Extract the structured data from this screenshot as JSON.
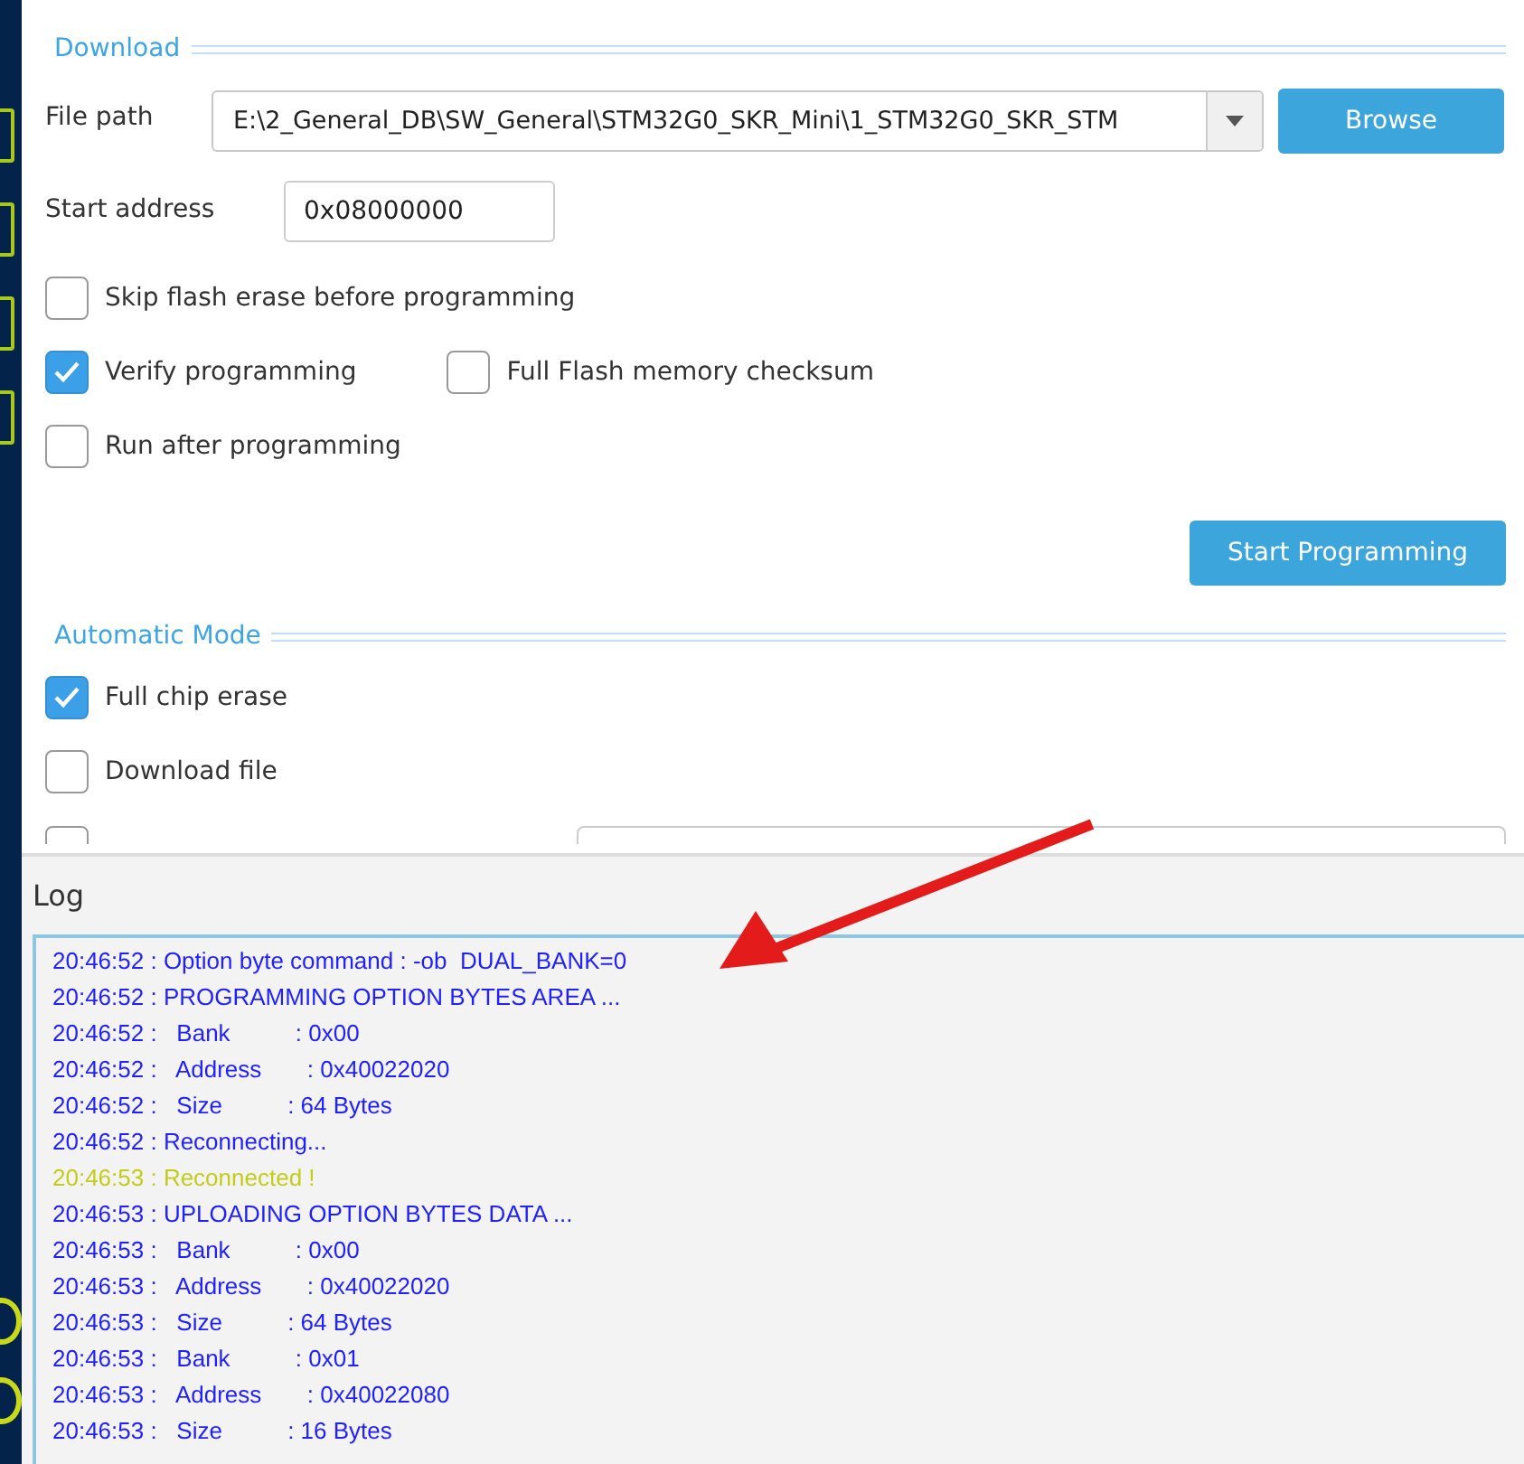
{
  "download": {
    "title": "Download",
    "file_path": {
      "label": "File path",
      "value": "E:\\2_General_DB\\SW_General\\STM32G0_SKR_Mini\\1_STM32G0_SKR_STM",
      "browse": "Browse"
    },
    "start_address": {
      "label": "Start address",
      "value": "0x08000000"
    },
    "options": [
      {
        "label": "Skip flash erase before programming",
        "checked": false
      },
      {
        "label": "Verify programming",
        "checked": true
      },
      {
        "label": "Full Flash memory checksum",
        "checked": false
      },
      {
        "label": "Run after programming",
        "checked": false
      }
    ],
    "start_button": "Start Programming"
  },
  "automatic_mode": {
    "title": "Automatic Mode",
    "options": [
      {
        "label": "Full chip erase",
        "checked": true
      },
      {
        "label": "Download file",
        "checked": false
      }
    ],
    "partial_option": {
      "checked": false
    }
  },
  "log": {
    "title": "Log",
    "lines": [
      {
        "kind": "info",
        "text": "20:46:52 : Option byte command : -ob  DUAL_BANK=0"
      },
      {
        "kind": "info",
        "text": "20:46:52 : PROGRAMMING OPTION BYTES AREA ..."
      },
      {
        "kind": "info",
        "text": "20:46:52 :   Bank          : 0x00"
      },
      {
        "kind": "info",
        "text": "20:46:52 :   Address       : 0x40022020"
      },
      {
        "kind": "info",
        "text": "20:46:52 :   Size          : 64 Bytes"
      },
      {
        "kind": "info",
        "text": "20:46:52 : Reconnecting..."
      },
      {
        "kind": "success",
        "text": "20:46:53 : Reconnected !"
      },
      {
        "kind": "info",
        "text": "20:46:53 : UPLOADING OPTION BYTES DATA ..."
      },
      {
        "kind": "info",
        "text": "20:46:53 :   Bank          : 0x00"
      },
      {
        "kind": "info",
        "text": "20:46:53 :   Address       : 0x40022020"
      },
      {
        "kind": "info",
        "text": "20:46:53 :   Size          : 64 Bytes"
      },
      {
        "kind": "info",
        "text": "20:46:53 :   Bank          : 0x01"
      },
      {
        "kind": "info",
        "text": "20:46:53 :   Address       : 0x40022080"
      },
      {
        "kind": "info",
        "text": "20:46:53 :   Size          : 16 Bytes"
      }
    ]
  }
}
